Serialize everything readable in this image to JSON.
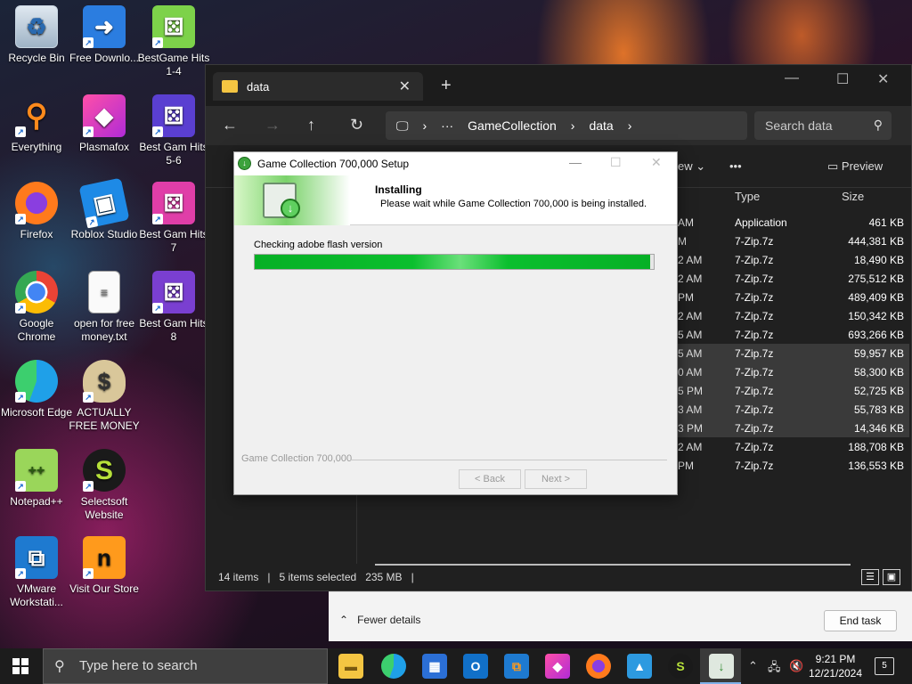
{
  "desktop_icons": [
    {
      "label": "Recycle Bin",
      "icon": "recycle-bin-icon"
    },
    {
      "label": "Free Downlo...",
      "icon": "download-icon"
    },
    {
      "label": "BestGame Hits 1-4",
      "icon": "dice-icon"
    },
    {
      "label": "Everything",
      "icon": "magnifier-icon"
    },
    {
      "label": "Plasmafox",
      "icon": "plasmafox-icon"
    },
    {
      "label": "Best Gam Hits 5-6",
      "icon": "dice-icon"
    },
    {
      "label": "Firefox",
      "icon": "firefox-icon"
    },
    {
      "label": "Roblox Studio",
      "icon": "roblox-studio-icon"
    },
    {
      "label": "Best Gam Hits 7",
      "icon": "dice-icon"
    },
    {
      "label": "Google Chrome",
      "icon": "chrome-icon"
    },
    {
      "label": "open for free money.txt",
      "icon": "text-file-icon"
    },
    {
      "label": "Best Gam Hits 8",
      "icon": "dice-icon"
    },
    {
      "label": "Microsoft Edge",
      "icon": "edge-icon"
    },
    {
      "label": "ACTUALLY FREE MONEY",
      "icon": "money-bag-icon"
    },
    {
      "label": "Notepad++",
      "icon": "notepad-plus-plus-icon"
    },
    {
      "label": "Selectsoft Website",
      "icon": "selectsoft-icon"
    },
    {
      "label": "VMware Workstati...",
      "icon": "vmware-icon"
    },
    {
      "label": "Visit Our Store",
      "icon": "store-icon"
    }
  ],
  "explorer": {
    "tab_title": "data",
    "new_tab": "+",
    "breadcrumb": [
      "GameCollection",
      "data"
    ],
    "search_placeholder": "Search data",
    "view_label": "ew",
    "more": "•••",
    "preview": "Preview",
    "columns": {
      "type": "Type",
      "size": "Size"
    },
    "rows": [
      {
        "partial": "AM",
        "type": "Application",
        "size": "461 KB",
        "selected": false
      },
      {
        "partial": "M",
        "type": "7-Zip.7z",
        "size": "444,381 KB",
        "selected": false
      },
      {
        "partial": "2 AM",
        "type": "7-Zip.7z",
        "size": "18,490 KB",
        "selected": false
      },
      {
        "partial": "2 AM",
        "type": "7-Zip.7z",
        "size": "275,512 KB",
        "selected": false
      },
      {
        "partial": "PM",
        "type": "7-Zip.7z",
        "size": "489,409 KB",
        "selected": false
      },
      {
        "partial": "2 AM",
        "type": "7-Zip.7z",
        "size": "150,342 KB",
        "selected": false
      },
      {
        "partial": "5 AM",
        "type": "7-Zip.7z",
        "size": "693,266 KB",
        "selected": false
      },
      {
        "partial": "5 AM",
        "type": "7-Zip.7z",
        "size": "59,957 KB",
        "selected": true
      },
      {
        "partial": "0 AM",
        "type": "7-Zip.7z",
        "size": "58,300 KB",
        "selected": true
      },
      {
        "partial": "5 PM",
        "type": "7-Zip.7z",
        "size": "52,725 KB",
        "selected": true
      },
      {
        "partial": "3 AM",
        "type": "7-Zip.7z",
        "size": "55,783 KB",
        "selected": true
      },
      {
        "partial": "3 PM",
        "type": "7-Zip.7z",
        "size": "14,346 KB",
        "selected": true
      },
      {
        "partial": "2 AM",
        "type": "7-Zip.7z",
        "size": "188,708 KB",
        "selected": false
      },
      {
        "partial": "PM",
        "type": "7-Zip.7z",
        "size": "136,553 KB",
        "selected": false
      }
    ],
    "status": {
      "items": "14 items",
      "selected": "5 items selected",
      "size": "235 MB"
    }
  },
  "taskmgr": {
    "fewer_details": "Fewer details",
    "end_task": "End task"
  },
  "setup": {
    "title": "Game Collection 700,000 Setup",
    "header_title": "Installing",
    "header_subtitle": "Please wait while Game Collection 700,000 is being installed.",
    "status_text": "Checking adobe flash version",
    "progress_fraction": 0.99,
    "branding": "Game Collection 700,000",
    "back_button": "< Back",
    "next_button": "Next >"
  },
  "taskbar": {
    "search_placeholder": "Type here to search",
    "time": "9:21 PM",
    "date": "12/21/2024",
    "notification_count": "5"
  },
  "colors": {
    "progress_green": "#06b025",
    "accent_blue": "#7fb0e8"
  }
}
